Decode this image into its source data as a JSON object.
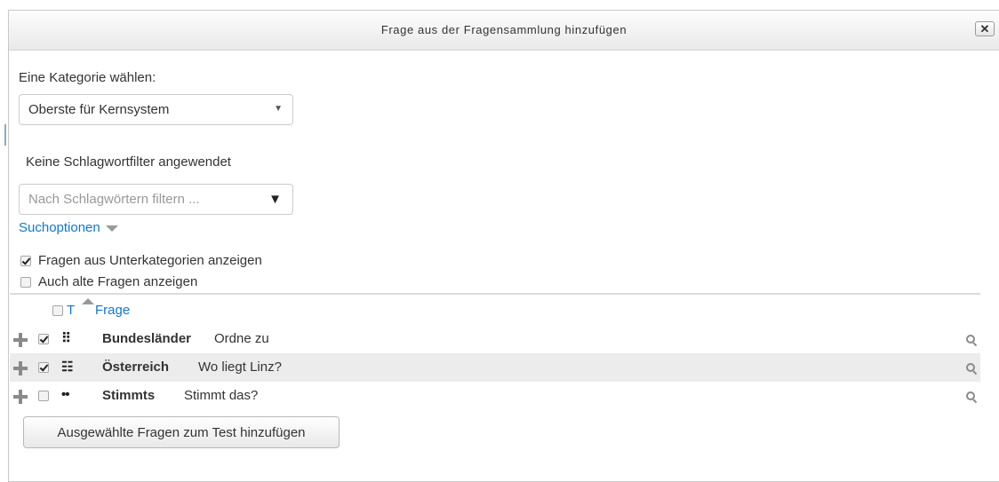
{
  "dialog": {
    "title": "Frage aus der Fragensammlung hinzufügen",
    "close_label": "✕"
  },
  "category": {
    "label": "Eine Kategorie wählen:",
    "selected": "Oberste für Kernsystem"
  },
  "tags": {
    "status": "Keine Schlagwortfilter angewendet",
    "placeholder": "Nach Schlagwörtern filtern ..."
  },
  "search_options": {
    "label": "Suchoptionen",
    "show_subcategories": {
      "label": "Fragen aus Unterkategorien anzeigen",
      "checked": true
    },
    "show_old": {
      "label": "Auch alte Fragen anzeigen",
      "checked": false
    }
  },
  "table": {
    "col_type": "T",
    "col_question": "Frage",
    "rows": [
      {
        "checked": true,
        "type_icon": "matching-icon",
        "name": "Bundesländer",
        "text": "Ordne zu"
      },
      {
        "checked": true,
        "type_icon": "multichoice-icon",
        "name": "Österreich",
        "text": "Wo liegt Linz?"
      },
      {
        "checked": false,
        "type_icon": "truefalse-icon",
        "name": "Stimmts",
        "text": "Stimmt das?"
      }
    ]
  },
  "submit_label": "Ausgewählte Fragen zum Test hinzufügen",
  "colors": {
    "link": "#1177d1",
    "row_alt": "#ececec"
  }
}
